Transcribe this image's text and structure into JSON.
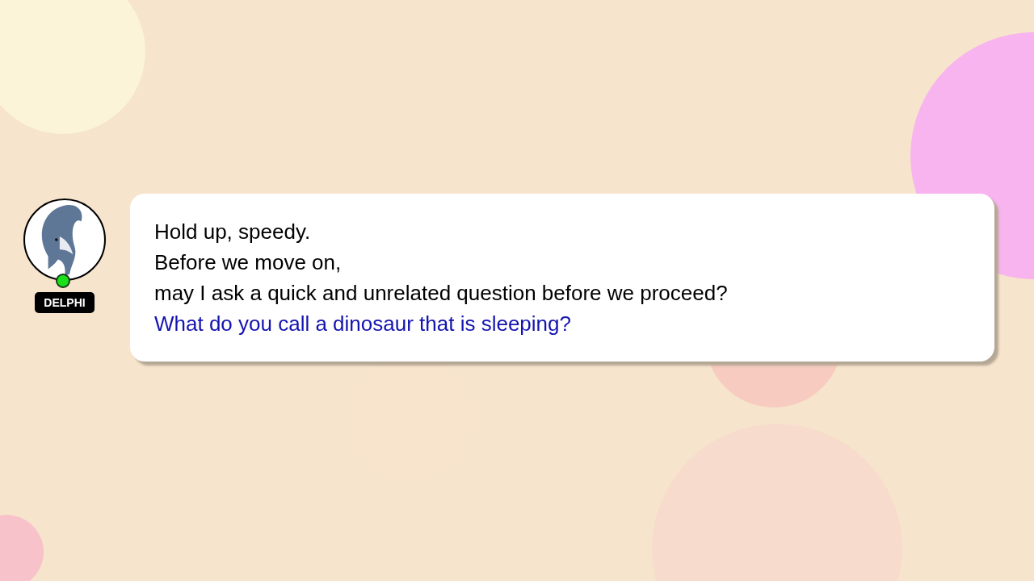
{
  "speaker": {
    "name": "DELPHI",
    "online": true
  },
  "message": {
    "lines": [
      {
        "kind": "statement",
        "text": "Hold up, speedy."
      },
      {
        "kind": "statement",
        "text": "Before we move on,"
      },
      {
        "kind": "statement",
        "text": "may I ask a quick and unrelated question before we proceed?"
      },
      {
        "kind": "question",
        "text": "What do you call a dinosaur that is sleeping?"
      }
    ]
  }
}
